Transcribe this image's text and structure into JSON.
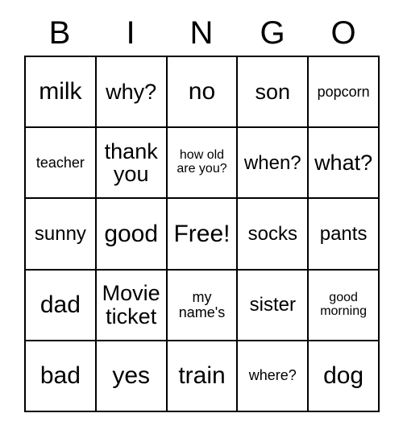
{
  "bingo": {
    "header": [
      "B",
      "I",
      "N",
      "G",
      "O"
    ],
    "rows": [
      [
        {
          "text": "milk",
          "size": "xl"
        },
        {
          "text": "why?",
          "size": "lg"
        },
        {
          "text": "no",
          "size": "xl"
        },
        {
          "text": "son",
          "size": "lg"
        },
        {
          "text": "popcorn",
          "size": "sm"
        }
      ],
      [
        {
          "text": "teacher",
          "size": "sm"
        },
        {
          "text": "thank you",
          "size": "lg"
        },
        {
          "text": "how old are you?",
          "size": "xs"
        },
        {
          "text": "when?",
          "size": "md"
        },
        {
          "text": "what?",
          "size": "lg"
        }
      ],
      [
        {
          "text": "sunny",
          "size": "md"
        },
        {
          "text": "good",
          "size": "xl"
        },
        {
          "text": "Free!",
          "size": "xl"
        },
        {
          "text": "socks",
          "size": "md"
        },
        {
          "text": "pants",
          "size": "md"
        }
      ],
      [
        {
          "text": "dad",
          "size": "xl"
        },
        {
          "text": "Movie ticket",
          "size": "lg"
        },
        {
          "text": "my name's",
          "size": "sm"
        },
        {
          "text": "sister",
          "size": "md"
        },
        {
          "text": "good morning",
          "size": "xs"
        }
      ],
      [
        {
          "text": "bad",
          "size": "xl"
        },
        {
          "text": "yes",
          "size": "xl"
        },
        {
          "text": "train",
          "size": "xl"
        },
        {
          "text": "where?",
          "size": "sm"
        },
        {
          "text": "dog",
          "size": "xl"
        }
      ]
    ]
  }
}
